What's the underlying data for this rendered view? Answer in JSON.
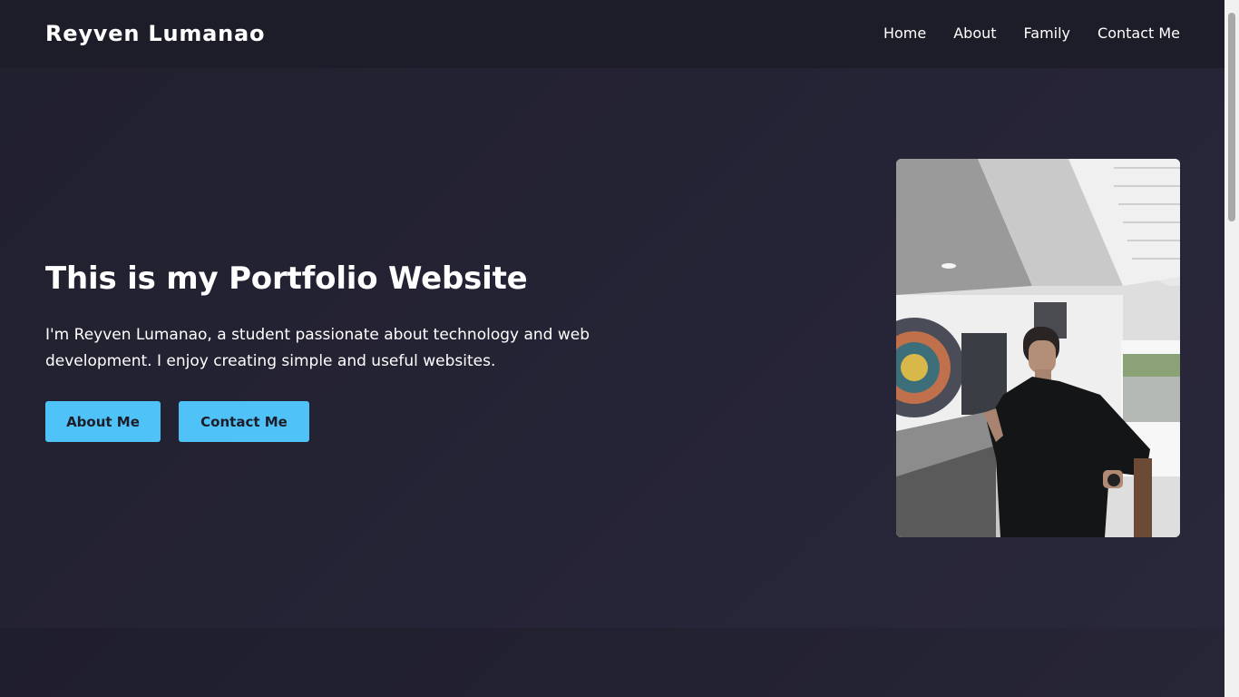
{
  "header": {
    "brand": "Reyven Lumanao",
    "nav": [
      "Home",
      "About",
      "Family",
      "Contact Me"
    ]
  },
  "hero": {
    "title": "This is my Portfolio Website",
    "description": "I'm Reyven Lumanao, a student passionate about technology and web development. I enjoy creating simple and useful websites.",
    "buttons": {
      "about": "About Me",
      "contact": "Contact Me"
    },
    "photo_icon": "portrait-photo"
  },
  "colors": {
    "background": "#1f1e2c",
    "navbar": "#1d1c29",
    "accent": "#4fc3f7",
    "text": "#ffffff"
  }
}
